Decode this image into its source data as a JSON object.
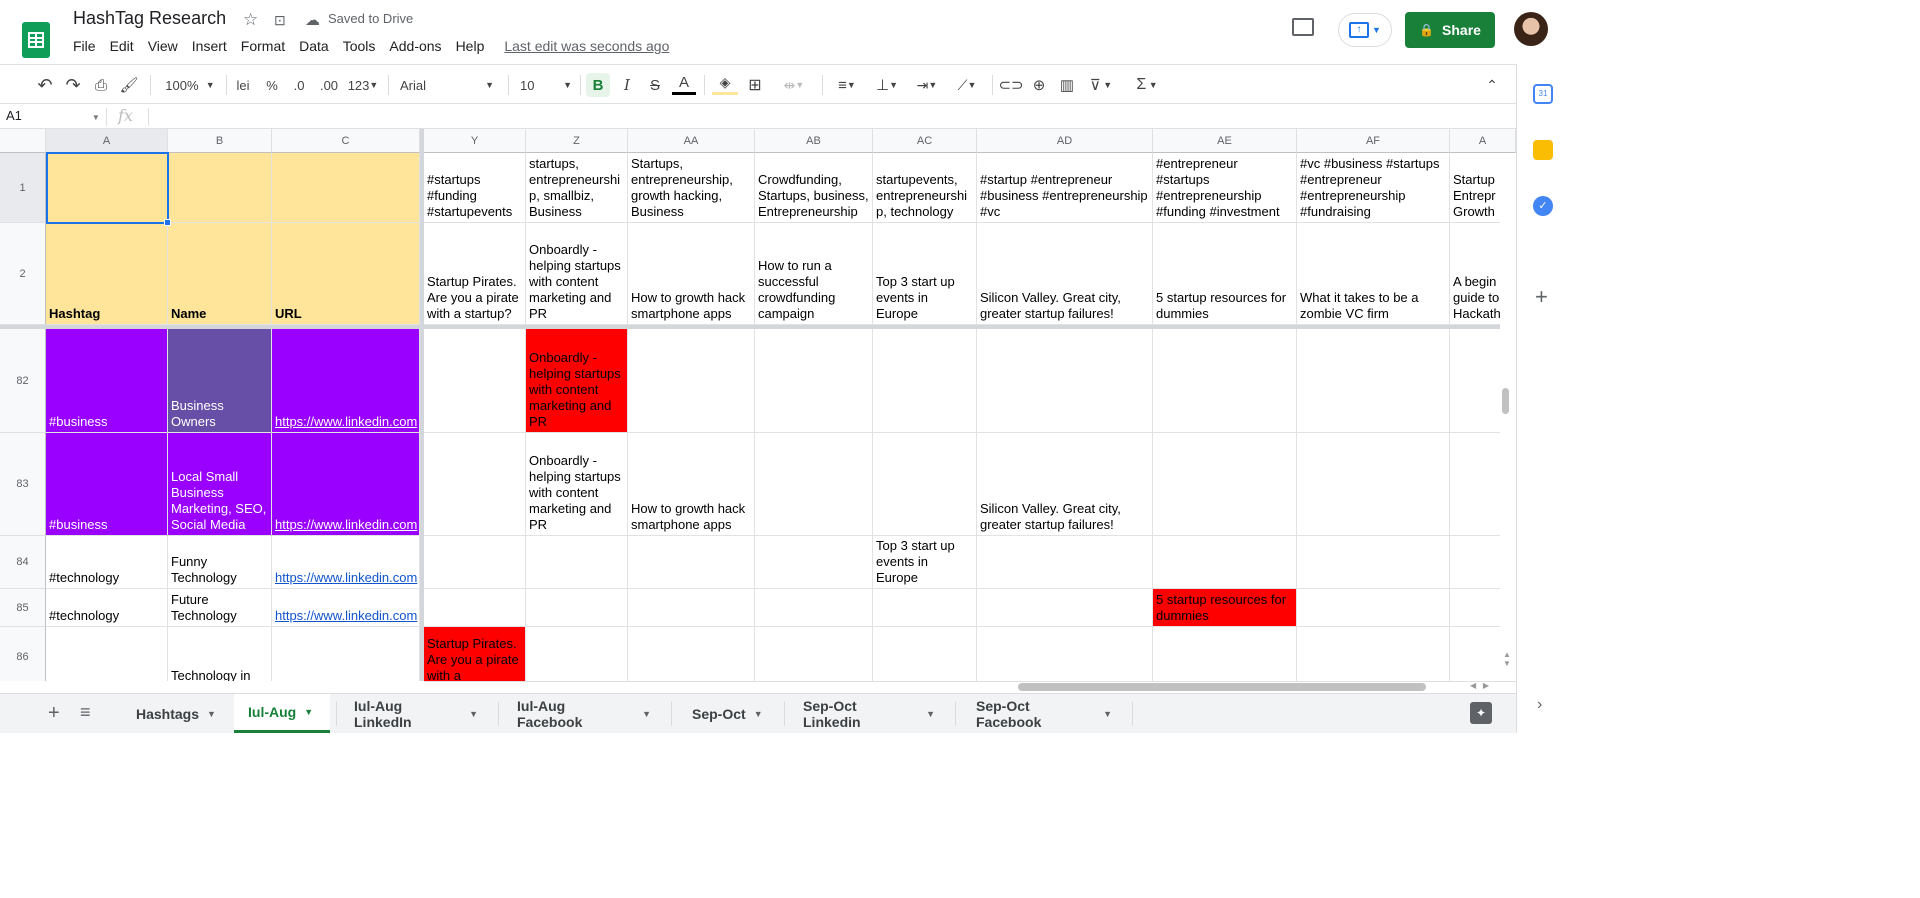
{
  "header": {
    "title": "HashTag Research",
    "saved": "Saved to Drive",
    "menu": [
      "File",
      "Edit",
      "View",
      "Insert",
      "Format",
      "Data",
      "Tools",
      "Add-ons",
      "Help"
    ],
    "last_edit": "Last edit was seconds ago",
    "share_label": "Share"
  },
  "toolbar": {
    "zoom": "100%",
    "currency": "lei",
    "percent": "%",
    "dec_less": ".0",
    "dec_more": ".00",
    "format_num": "123",
    "font": "Arial",
    "font_size": "10",
    "bold": "B",
    "italic": "I",
    "strike": "S",
    "text_color": "A"
  },
  "formula": {
    "namebox": "A1",
    "fx": "fx"
  },
  "columns": [
    "A",
    "B",
    "C",
    "Y",
    "Z",
    "AA",
    "AB",
    "AC",
    "AD",
    "AE",
    "AF",
    "A"
  ],
  "rows": {
    "r1": {
      "num": "1",
      "cells": [
        "",
        "",
        "",
        "#startups #funding #startupevents",
        "startups, entrepreneurship, smallbiz, Business",
        "Startups, entrepreneurship, growth hacking, Business",
        "Crowdfunding, Startups, business, Entrepreneurship",
        "startupevents, entrepreneurship, technology",
        "#startup #entrepreneur #business #entrepreneurship #vc",
        "#entrepreneur #startups #entrepreneurship #funding #investment",
        "#vc #business #startups #entrepreneur #entrepreneurship #fundraising",
        "Startup Entrepr Growth"
      ]
    },
    "r2": {
      "num": "2",
      "cells": [
        "Hashtag",
        "Name",
        "URL",
        "Startup Pirates. Are you a pirate with a startup?",
        "Onboardly - helping startups with content marketing and PR",
        "How to growth hack smartphone apps",
        "How to run a successful crowdfunding campaign",
        "Top 3 start up events in Europe",
        "Silicon Valley. Great city, greater startup failures!",
        "5 startup resources for dummies",
        "What it takes to be a zombie VC firm",
        "A begin guide to Hackath"
      ]
    },
    "r82": {
      "num": "82",
      "cells": [
        "#business",
        "Business Owners",
        "https://www.linkedin.com",
        "",
        "Onboardly - helping startups with content marketing and PR",
        "",
        "",
        "",
        "",
        "",
        "",
        ""
      ]
    },
    "r83": {
      "num": "83",
      "cells": [
        "#business",
        "Local Small Business Marketing, SEO, Social Media",
        "https://www.linkedin.com",
        "",
        "Onboardly - helping startups with content marketing and PR",
        "How to growth hack smartphone apps",
        "",
        "",
        "Silicon Valley. Great city, greater startup failures!",
        "",
        "",
        ""
      ]
    },
    "r84": {
      "num": "84",
      "cells": [
        "#technology",
        "Funny Technology",
        "https://www.linkedin.com",
        "",
        "",
        "",
        "",
        "Top 3 start up events in Europe",
        "",
        "",
        "",
        ""
      ]
    },
    "r85": {
      "num": "85",
      "cells": [
        "#technology",
        "Future Technology",
        "https://www.linkedin.com",
        "",
        "",
        "",
        "",
        "",
        "",
        "5 startup resources for dummies",
        "",
        ""
      ]
    },
    "r86": {
      "num": "86",
      "cells": [
        "",
        "Technology in",
        "",
        "Startup Pirates. Are you a pirate with a",
        "",
        "",
        "",
        "",
        "",
        "",
        "",
        ""
      ]
    }
  },
  "colors": {
    "header_yellow": "#ffe599",
    "purple": "#9900ff",
    "purple_muted": "#674ea7",
    "red": "#ff0000",
    "green": "#188038",
    "link": "#1155cc"
  },
  "tabs": [
    {
      "label": "Hashtags"
    },
    {
      "label": "Iul-Aug"
    },
    {
      "label": "Iul-Aug LinkedIn"
    },
    {
      "label": "Iul-Aug Facebook"
    },
    {
      "label": "Sep-Oct"
    },
    {
      "label": "Sep-Oct Linkedin"
    },
    {
      "label": "Sep-Oct Facebook"
    }
  ],
  "active_tab": "Iul-Aug",
  "side_icons": [
    "calendar-icon",
    "keep-icon",
    "tasks-icon",
    "add-icon"
  ]
}
